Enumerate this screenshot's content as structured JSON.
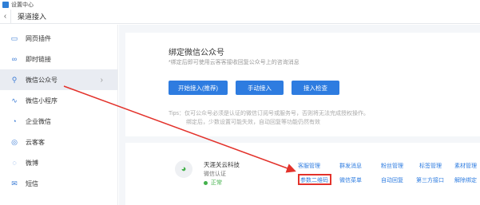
{
  "window": {
    "title": "设置中心"
  },
  "navbar": {
    "back_icon": "chevron-left-icon",
    "title": "渠道接入"
  },
  "sidebar": {
    "items": [
      {
        "label": "网页插件",
        "icon": "monitor-icon",
        "glyph": "▭"
      },
      {
        "label": "即时链接",
        "icon": "link-icon",
        "glyph": "∞"
      },
      {
        "label": "微信公众号",
        "icon": "wechat-link-icon",
        "glyph": "⚲",
        "active": true
      },
      {
        "label": "微信小程序",
        "icon": "mini-program-icon",
        "glyph": "∿"
      },
      {
        "label": "企业微信",
        "icon": "wecom-icon",
        "glyph": "◔"
      },
      {
        "label": "云客客",
        "icon": "chat-bubble-icon",
        "glyph": "◎"
      },
      {
        "label": "微博",
        "icon": "weibo-icon",
        "glyph": "◌"
      },
      {
        "label": "短信",
        "icon": "sms-icon",
        "glyph": "✉"
      }
    ]
  },
  "bind_card": {
    "title": "绑定微信公众号",
    "description": "*绑定后即可使用云客客接收回复公众号上的咨询消息",
    "buttons": [
      "开始接入(推荐)",
      "手动接入",
      "接入检查"
    ],
    "tip_line1": "Tips：仅可公众号必须是认证的微信订阅号或服务号，否则将无法完成授权操作。",
    "tip_line2": "绑定后，少数设置可能失效，自动回复等功能仍然有效"
  },
  "account_card": {
    "logo_icon": "wechat-icon",
    "name": "天涯关云科技",
    "type": "微信认证",
    "status": "正常",
    "actions_row1": [
      "客服管理",
      "群发消息",
      "粉丝管理",
      "标签管理",
      "素材管理"
    ],
    "actions_row2": [
      "参数二维码",
      "微信菜单",
      "自动回复",
      "第三方接口",
      "解除绑定"
    ],
    "highlighted_action": "参数二维码"
  },
  "colors": {
    "accent": "#2e7ce0",
    "highlight": "#e3322b",
    "success": "#43b14b"
  }
}
